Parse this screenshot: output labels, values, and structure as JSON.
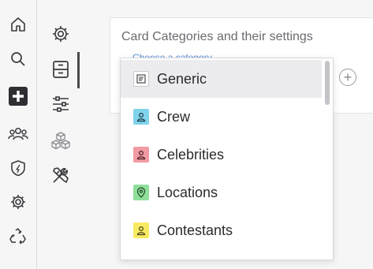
{
  "rail": {
    "icons": [
      "home-icon",
      "search-icon",
      "add-icon",
      "people-icon",
      "shield-icon",
      "gear-icon",
      "recycle-icon"
    ]
  },
  "subnav": {
    "icons": [
      "gear-icon",
      "cabinet-icon",
      "sliders-icon",
      "boxes-icon",
      "tools-icon"
    ]
  },
  "card": {
    "title": "Card Categories and their settings",
    "placeholder": "Choose a category"
  },
  "dropdown": {
    "options": [
      {
        "label": "Generic",
        "icon": "document-icon",
        "color": "#ffffff"
      },
      {
        "label": "Crew",
        "icon": "person-icon",
        "color": "#7fd3ea"
      },
      {
        "label": "Celebrities",
        "icon": "person-icon",
        "color": "#f29aa3"
      },
      {
        "label": "Locations",
        "icon": "pin-icon",
        "color": "#8fdf9a"
      },
      {
        "label": "Contestants",
        "icon": "person-icon",
        "color": "#f7ea62"
      }
    ],
    "selected_index": 0
  }
}
